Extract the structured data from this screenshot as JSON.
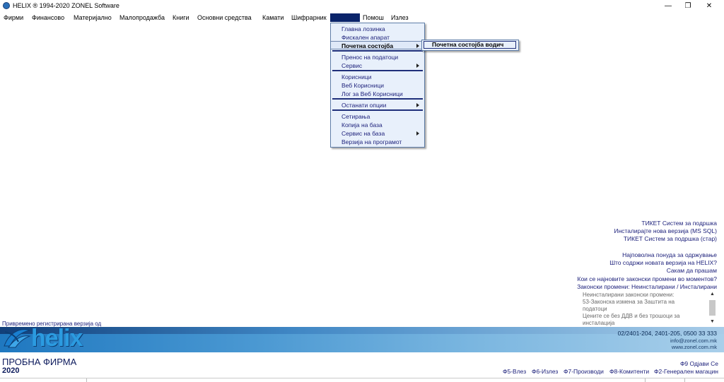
{
  "window": {
    "title": "HELIX ® 1994-2020  ZONEL Software",
    "minimize": "—",
    "restore": "❐",
    "close": "✕"
  },
  "menubar": {
    "items": [
      "Фирми",
      "Финансово",
      "Материјално",
      "Малопродажба",
      "Книги",
      "Основни средства",
      "Камати",
      "Шифрарник",
      "",
      "Помош",
      "Излез"
    ]
  },
  "dropdown": {
    "items": [
      "Главна лозинка",
      "Фискален апарат",
      "Почетна состојба",
      "Пренос на податоци",
      "Сервис",
      "Корисници",
      "Веб Корисници",
      "Лог за Веб Корисници",
      "Останати опции",
      "Сетирања",
      "Копија на база",
      "Сервис на база",
      "Верзија на програмот"
    ]
  },
  "submenu": {
    "label": "Почетна состојба водич"
  },
  "right_links": {
    "ticket": "ТИКЕТ Систем за подршка",
    "install_new": "Инсталирајте нова верзија (MS SQL)",
    "ticket_old": "ТИКЕТ Систем за подршка (стар)",
    "maintenance": "Најповолна понуда за одржување",
    "new_version": "Што содржи новата верзија на HELIX?",
    "ask": "Сакам да прашам",
    "legal": "Кои се најновите законски промени во моментов?",
    "legal_changes": "Законски промени: Неинсталирани / Инсталирани"
  },
  "news": {
    "lines": [
      "Неинсталирани законски промени:",
      "53-Законска измена за Заштита на",
      "податоци",
      "Цените се без ДДВ и без трошоци за",
      "инсталација"
    ]
  },
  "registration": "Привремено регистрирана верзија од",
  "banner": {
    "logo": "helix",
    "phone": "02/2401-204, 2401-205, 0500 33 333",
    "email": "info@zonel.com.mk",
    "web": "www.zonel.com.mk"
  },
  "footer": {
    "firm": "ПРОБНА ФИРМА",
    "year": "2020",
    "f9": "Ф9 Одјави Се",
    "fkeys": [
      "Ф5-Влез",
      "Ф6-Излез",
      "Ф7-Производи",
      "Ф8-Комитенти",
      "Ф2-Генерален магацин"
    ]
  },
  "colors": {
    "menu_highlight": "#0a246a",
    "link_text": "#1b1f7a",
    "dropdown_bg": "#e8f0fb",
    "logo_blue": "#2b9be0"
  }
}
